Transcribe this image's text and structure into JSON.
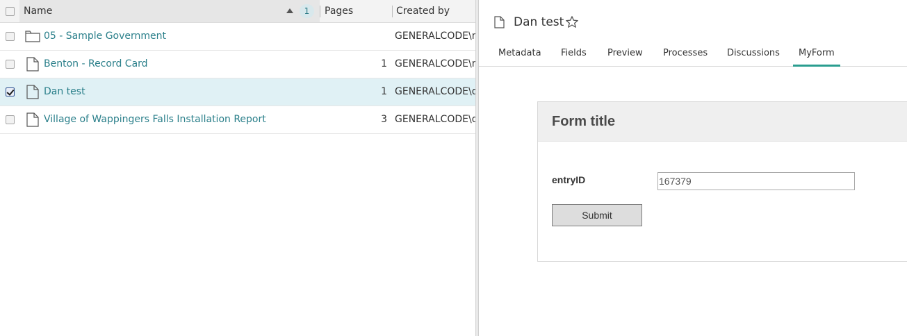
{
  "list": {
    "columns": {
      "name": "Name",
      "sort_badge": "1",
      "pages": "Pages",
      "created_by": "Created by"
    },
    "rows": [
      {
        "type": "folder-icon",
        "name": "05 - Sample Government",
        "pages": "",
        "created_by": "GENERALCODE\\m",
        "selected": false
      },
      {
        "type": "document-icon",
        "name": "Benton - Record Card",
        "pages": "1",
        "created_by": "GENERALCODE\\m",
        "selected": false
      },
      {
        "type": "document-icon",
        "name": "Dan test",
        "pages": "1",
        "created_by": "GENERALCODE\\ds",
        "selected": true
      },
      {
        "type": "document-icon",
        "name": "Village of Wappingers Falls Installation Report",
        "pages": "3",
        "created_by": "GENERALCODE\\dt",
        "selected": false
      }
    ]
  },
  "detail": {
    "title": "Dan test",
    "tabs": [
      {
        "label": "Metadata"
      },
      {
        "label": "Fields"
      },
      {
        "label": "Preview"
      },
      {
        "label": "Processes"
      },
      {
        "label": "Discussions"
      },
      {
        "label": "MyForm"
      }
    ],
    "active_tab": "MyForm",
    "form": {
      "title": "Form title",
      "field_label": "entryID",
      "field_value": "167379",
      "submit_label": "Submit"
    }
  },
  "colors": {
    "link": "#2a7f8a",
    "accent": "#2a9d8f",
    "selected_row": "#e0f1f5"
  }
}
